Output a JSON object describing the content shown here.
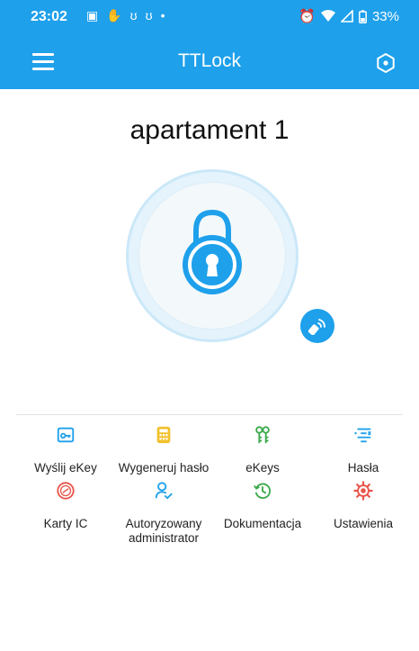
{
  "status_bar": {
    "time": "23:02",
    "battery": "33%",
    "left_icons": [
      "image-icon",
      "hand-icon",
      "notification-icon",
      "notification-icon",
      "dot-icon"
    ],
    "right_icons": [
      "alarm-icon",
      "wifi-icon",
      "signal-icon",
      "battery-icon"
    ]
  },
  "app_bar": {
    "title": "TTLock",
    "left_icon": "menu-icon",
    "right_icon": "settings-icon"
  },
  "lock": {
    "name": "apartament 1"
  },
  "menu": [
    {
      "label": "Wyślij eKey",
      "icon": "send-ekey-icon"
    },
    {
      "label": "Wygeneruj hasło",
      "icon": "generate-passcode-icon"
    },
    {
      "label": "eKeys",
      "icon": "ekeys-icon"
    },
    {
      "label": "Hasła",
      "icon": "passcodes-icon"
    },
    {
      "label": "Karty IC",
      "icon": "ic-card-icon"
    },
    {
      "label": "Autoryzowany administrator",
      "icon": "admin-icon"
    },
    {
      "label": "Dokumentacja",
      "icon": "records-icon"
    },
    {
      "label": "Ustawienia",
      "icon": "settings-gear-icon"
    }
  ],
  "colors": {
    "primary": "#1ea0eb",
    "ic_cards": "#e8544a",
    "settings": "#e8544a",
    "ekeys": "#3aa94a",
    "records": "#3aa94a",
    "passcode": "#f2c12e",
    "admin": "#1ea0eb",
    "passcodes": "#1ea0eb",
    "send_ekey": "#1ea0eb"
  }
}
